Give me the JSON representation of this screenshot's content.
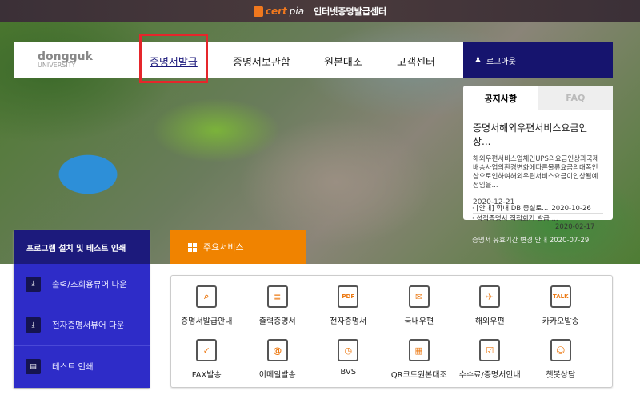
{
  "header": {
    "brand": "cert",
    "brand_suffix": "pia",
    "title": "인터넷증명발급센터"
  },
  "nav": {
    "logo_top": "dongguk",
    "logo_bottom": "UNIVERSITY",
    "items": [
      "증명서발급",
      "증명서보관함",
      "원본대조",
      "고객센터"
    ],
    "logout": "로그아웃",
    "highlighted": "증명서발급"
  },
  "notice": {
    "tabs": [
      "공지사항",
      "FAQ"
    ],
    "active_tab": "공지사항",
    "featured_title": "증명서해외우편서비스요금인상...",
    "featured_body": "해외우편서비스업체인UPS의요금인상과국제배송사업의환경변화에따른물류요금의대폭인상으로인하여해외우편서비스요금이인상될예정임을...",
    "featured_date": "2020-12-21",
    "list": [
      {
        "title": "[안내] 학내 DB 증설로...",
        "date": "2020-10-26"
      },
      {
        "title": "성적증명서 직접회기 발급 ...",
        "date": "2020-02-17"
      },
      {
        "title": "증명서 유효기간 변경 안내",
        "date": "2020-07-29"
      }
    ]
  },
  "left_panel": {
    "title": "프로그램 설치 및 테스트 인쇄",
    "items": [
      {
        "label": "출력/조회용뷰어 다운",
        "icon": "download-icon"
      },
      {
        "label": "전자증명서뷰어 다운",
        "icon": "download-icon"
      },
      {
        "label": "테스트 인쇄",
        "icon": "printer-icon"
      }
    ]
  },
  "services": {
    "tab": "주요서비스",
    "items": [
      {
        "label": "증명서발급안내",
        "icon": "search-document-icon"
      },
      {
        "label": "출력증명서",
        "icon": "printed-document-icon"
      },
      {
        "label": "전자증명서",
        "icon": "pdf-icon"
      },
      {
        "label": "국내우편",
        "icon": "envelope-icon"
      },
      {
        "label": "해외우편",
        "icon": "international-mail-icon"
      },
      {
        "label": "카카오발송",
        "icon": "kakao-talk-icon"
      },
      {
        "label": "FAX발송",
        "icon": "fax-icon"
      },
      {
        "label": "이메일발송",
        "icon": "email-icon"
      },
      {
        "label": "BVS",
        "icon": "clock-document-icon"
      },
      {
        "label": "QR코드원본대조",
        "icon": "qr-code-icon"
      },
      {
        "label": "수수료/증명서안내",
        "icon": "checklist-icon"
      },
      {
        "label": "챗봇상담",
        "icon": "chatbot-icon"
      }
    ]
  },
  "colors": {
    "navy": "#16146e",
    "blue": "#2e2cc8",
    "orange": "#f08300",
    "highlight": "#e5262b"
  }
}
